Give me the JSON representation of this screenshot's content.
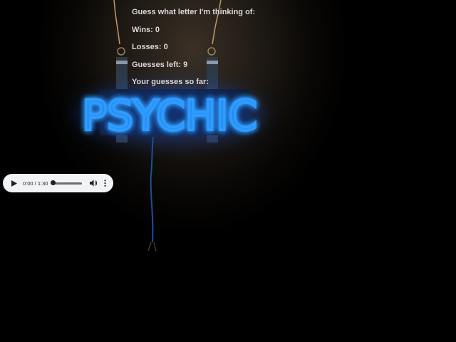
{
  "game": {
    "prompt": "Guess what letter I'm thinking of:",
    "wins_label": "Wins:",
    "wins": "0",
    "losses_label": "Losses:",
    "losses": "0",
    "guesses_left_label": "Guesses left:",
    "guesses_left": "9",
    "guesses_so_far_label": "Your guesses so far:",
    "guesses_so_far": ""
  },
  "background": {
    "sign_text": "PSYCHIC",
    "neon_color": "#2f9bff",
    "neon_glow": "#1a5dff"
  },
  "audio_player": {
    "time": "0:00 / 1:30",
    "progress": 0,
    "play_icon": "play-icon",
    "volume_icon": "volume-icon",
    "menu_icon": "more-vert-icon"
  }
}
